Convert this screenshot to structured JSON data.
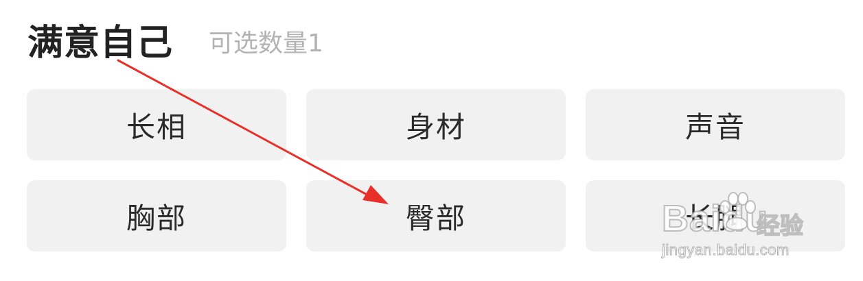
{
  "section": {
    "title": "满意自己",
    "subtitle": "可选数量1"
  },
  "options": [
    {
      "label": "长相"
    },
    {
      "label": "身材"
    },
    {
      "label": "声音"
    },
    {
      "label": "胸部"
    },
    {
      "label": "臀部"
    },
    {
      "label": "长腿"
    }
  ],
  "annotation": {
    "arrow_color": "#e8302a"
  },
  "watermark": {
    "brand": "Baidu",
    "brand_cn": "经验",
    "url": "jingyan.baidu.com"
  }
}
